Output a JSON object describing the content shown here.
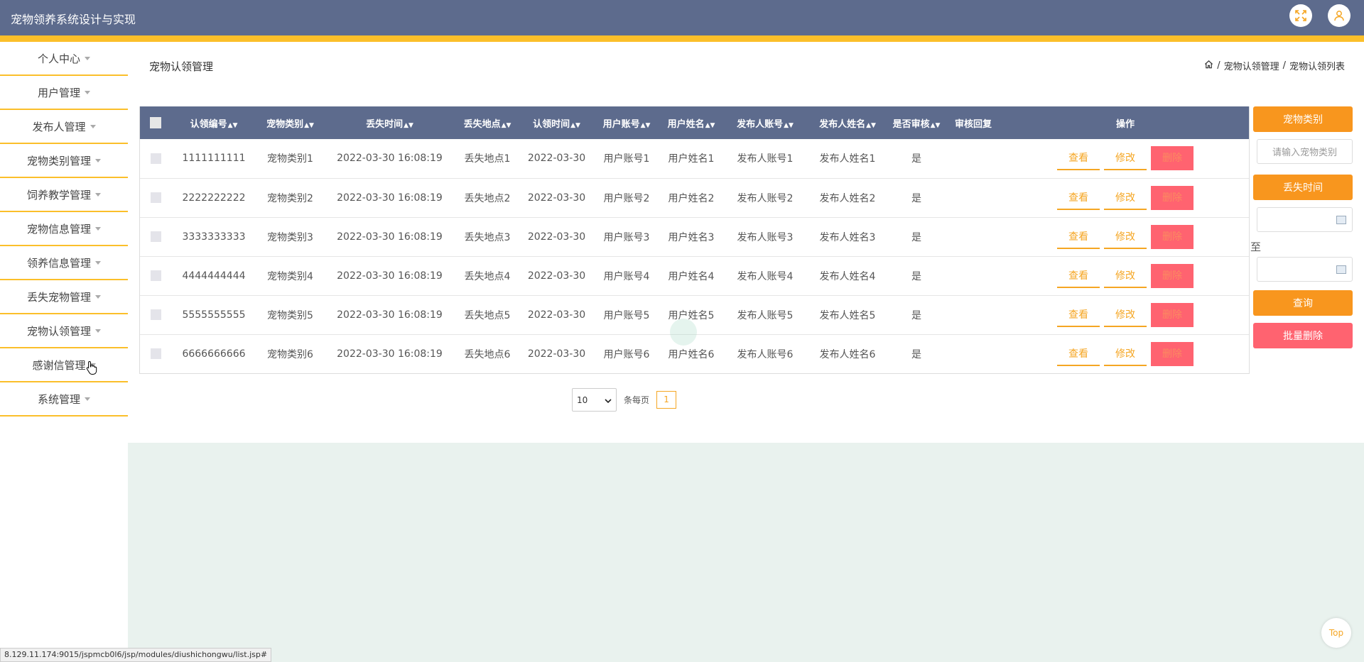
{
  "app": {
    "title": "宠物领养系统设计与实现"
  },
  "icons": {
    "fullscreen": "expand-icon",
    "user": "user-icon",
    "home": "home-icon",
    "calendar": "calendar-icon"
  },
  "colors": {
    "header": "#5d6b8d",
    "accent": "#fbbf2a",
    "button": "#f8961e",
    "delete": "#ff6370",
    "content_bg": "#e9f2ee"
  },
  "sidebar": {
    "items": [
      {
        "label": "个人中心"
      },
      {
        "label": "用户管理"
      },
      {
        "label": "发布人管理"
      },
      {
        "label": "宠物类别管理"
      },
      {
        "label": "饲养教学管理"
      },
      {
        "label": "宠物信息管理"
      },
      {
        "label": "领养信息管理"
      },
      {
        "label": "丢失宠物管理"
      },
      {
        "label": "宠物认领管理"
      },
      {
        "label": "感谢信管理"
      },
      {
        "label": "系统管理"
      }
    ]
  },
  "page": {
    "title": "宠物认领管理",
    "breadcrumb": {
      "section": "宠物认领管理",
      "separator": "/",
      "current": "宠物认领列表"
    }
  },
  "table": {
    "columns": [
      "认领编号",
      "宠物类别",
      "丢失时间",
      "丢失地点",
      "认领时间",
      "用户账号",
      "用户姓名",
      "发布人账号",
      "发布人姓名",
      "是否审核",
      "审核回复",
      "操作"
    ],
    "rows": [
      [
        "1111111111",
        "宠物类别1",
        "2022-03-30 16:08:19",
        "丢失地点1",
        "2022-03-30",
        "用户账号1",
        "用户姓名1",
        "发布人账号1",
        "发布人姓名1",
        "是",
        ""
      ],
      [
        "2222222222",
        "宠物类别2",
        "2022-03-30 16:08:19",
        "丢失地点2",
        "2022-03-30",
        "用户账号2",
        "用户姓名2",
        "发布人账号2",
        "发布人姓名2",
        "是",
        ""
      ],
      [
        "3333333333",
        "宠物类别3",
        "2022-03-30 16:08:19",
        "丢失地点3",
        "2022-03-30",
        "用户账号3",
        "用户姓名3",
        "发布人账号3",
        "发布人姓名3",
        "是",
        ""
      ],
      [
        "4444444444",
        "宠物类别4",
        "2022-03-30 16:08:19",
        "丢失地点4",
        "2022-03-30",
        "用户账号4",
        "用户姓名4",
        "发布人账号4",
        "发布人姓名4",
        "是",
        ""
      ],
      [
        "5555555555",
        "宠物类别5",
        "2022-03-30 16:08:19",
        "丢失地点5",
        "2022-03-30",
        "用户账号5",
        "用户姓名5",
        "发布人账号5",
        "发布人姓名5",
        "是",
        ""
      ],
      [
        "6666666666",
        "宠物类别6",
        "2022-03-30 16:08:19",
        "丢失地点6",
        "2022-03-30",
        "用户账号6",
        "用户姓名6",
        "发布人账号6",
        "发布人姓名6",
        "是",
        ""
      ]
    ],
    "actions": {
      "view": "查看",
      "edit": "修改",
      "delete": "删除"
    }
  },
  "pagination": {
    "page_size": "10",
    "per_page_label": "条每页",
    "current_page": "1"
  },
  "filters": {
    "category_label": "宠物类别",
    "category_placeholder": "请输入宠物类别",
    "lost_time_label": "丢失时间",
    "range_separator": "至",
    "search_button": "查询",
    "batch_delete_button": "批量删除"
  },
  "top_button": "Top",
  "status_bar": {
    "url": "8.129.11.174:9015/jspmcb0l6/jsp/modules/diushichongwu/list.jsp#"
  }
}
